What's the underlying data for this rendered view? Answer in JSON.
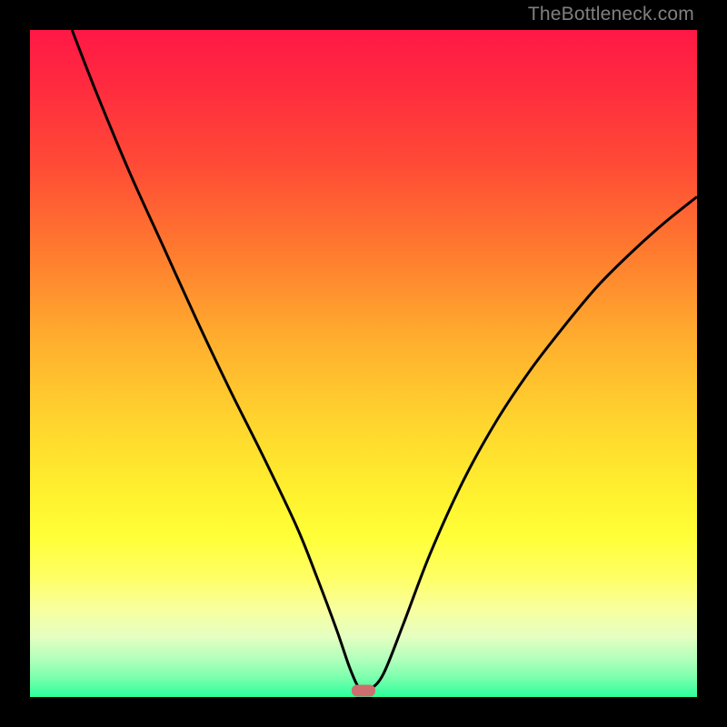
{
  "watermark": "TheBottleneck.com",
  "colors": {
    "curve": "#000000",
    "marker": "#cd6f6e",
    "frame": "#000000"
  },
  "chart_data": {
    "type": "line",
    "title": "",
    "xlabel": "",
    "ylabel": "",
    "xlim": [
      0,
      100
    ],
    "ylim": [
      0,
      100
    ],
    "grid": false,
    "legend": false,
    "annotations": [
      {
        "text": "TheBottleneck.com",
        "position": "top-right",
        "color": "#808080"
      }
    ],
    "marker": {
      "x": 50.0,
      "y": 1.0,
      "shape": "rounded-rect",
      "color": "#cd6f6e"
    },
    "series": [
      {
        "name": "bottleneck-curve",
        "color": "#000000",
        "x": [
          6.3,
          10,
          15,
          20,
          25,
          30,
          35,
          40,
          43,
          46,
          48,
          49.5,
          51,
          53,
          56,
          60,
          65,
          70,
          75,
          80,
          85,
          90,
          95,
          100
        ],
        "y": [
          100,
          90.5,
          78.5,
          67.5,
          56.5,
          46,
          36,
          25.5,
          18,
          10,
          4.2,
          1.2,
          1.2,
          3.5,
          11,
          21.5,
          32.5,
          41.5,
          49,
          55.5,
          61.5,
          66.5,
          71,
          75
        ]
      }
    ],
    "background_gradient": {
      "direction": "vertical",
      "stops": [
        {
          "pos": 0.0,
          "color": "#ff1846"
        },
        {
          "pos": 0.2,
          "color": "#ff4a36"
        },
        {
          "pos": 0.47,
          "color": "#ffb02e"
        },
        {
          "pos": 0.7,
          "color": "#fff22f"
        },
        {
          "pos": 0.87,
          "color": "#f8ffa0"
        },
        {
          "pos": 1.0,
          "color": "#2bff9b"
        }
      ]
    }
  }
}
